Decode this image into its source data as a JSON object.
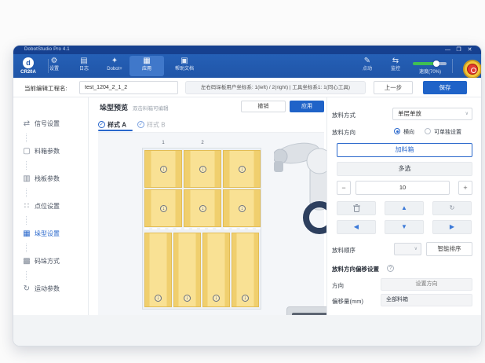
{
  "window": {
    "title": "DobotStudio Pro 4.1",
    "min": "—",
    "restore": "❐",
    "close": "✕"
  },
  "toolbar": {
    "robot_model": "CR20A",
    "logo_letter": "d",
    "items": [
      {
        "label": "设置",
        "icon": "⚙"
      },
      {
        "label": "日志",
        "icon": "▤"
      },
      {
        "label": "Dobot+",
        "icon": "✦"
      },
      {
        "label": "应用",
        "icon": "▦"
      },
      {
        "label": "帮助文档",
        "icon": "▣"
      }
    ],
    "jog": {
      "label": "点动",
      "icon": "✎"
    },
    "monitor": {
      "label": "监控",
      "icon": "⇆"
    },
    "speed_label": "速度(70%)",
    "speed_percent": 70
  },
  "project_bar": {
    "name_label": "当前编辑工程名:",
    "name_value": "test_1204_2_1_2",
    "coord_info": "左右码垛板用户坐标系: 1(left) / 2(right) | 工具坐标系1: 1(同心工具)",
    "prev_label": "上一步",
    "save_label": "保存"
  },
  "sidebar": {
    "items": [
      {
        "label": "信号设置",
        "icon": "⇄"
      },
      {
        "label": "料箱参数",
        "icon": "▢"
      },
      {
        "label": "栈板参数",
        "icon": "▥"
      },
      {
        "label": "点位设置",
        "icon": "∷"
      },
      {
        "label": "垛型设置",
        "icon": "▦",
        "active": true
      },
      {
        "label": "码垛方式",
        "icon": "▩"
      },
      {
        "label": "运动参数",
        "icon": "↻"
      }
    ]
  },
  "canvas": {
    "title": "垛型预览",
    "hint": "双击料箱可编辑",
    "undo_label": "撤销",
    "apply_label": "应用",
    "tab_a": "样式 A",
    "tab_b": "样式 B",
    "check": "✓",
    "box_numbers": [
      "1",
      "2"
    ],
    "box_marker": "↓"
  },
  "right_panel": {
    "place_mode_label": "放料方式",
    "place_mode_value": "单层单放",
    "chevron": "∨",
    "direction_label": "放料方向",
    "direction_options": [
      "横向",
      "可单独设置"
    ],
    "direction_selected": "横向",
    "add_box_label": "加料箱",
    "multi_select_label": "多选",
    "count_value": "10",
    "minus": "−",
    "plus": "+",
    "arrows": {
      "up": "▲",
      "down": "▼",
      "left": "◀",
      "right": "▶",
      "rotate": "↻"
    },
    "order_label": "放料顺序",
    "smart_sort_label": "智能排序",
    "offset_title": "放料方向偏移设置",
    "help": "?",
    "direction_field_label": "方向",
    "direction_field_value": "设置方向",
    "offset_field_label": "偏移量(mm)",
    "offset_field_value": "全部料箱"
  },
  "colors": {
    "accent": "#2a68cc",
    "toolbar": "#2257ac",
    "titlebar": "#16408f",
    "box_yellow": "#f7dc86",
    "estop_red": "#e23a2e",
    "estop_ring": "#f3c73c",
    "slider_green": "#3fbf53"
  }
}
